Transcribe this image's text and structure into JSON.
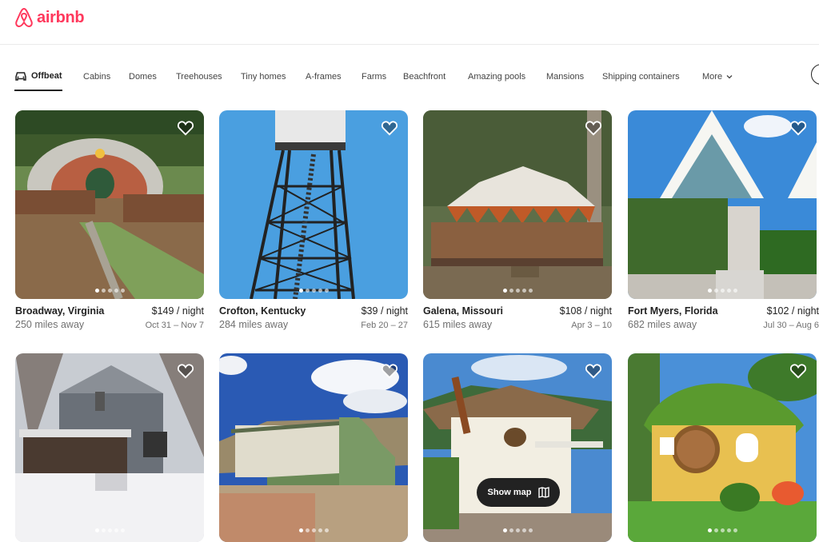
{
  "brand": {
    "name": "airbnb",
    "color": "#ff385c"
  },
  "categories": [
    {
      "label": "Offbeat",
      "icon": "car-icon",
      "active": true
    },
    {
      "label": "Cabins"
    },
    {
      "label": "Domes"
    },
    {
      "label": "Treehouses"
    },
    {
      "label": "Tiny homes"
    },
    {
      "label": "A-frames"
    },
    {
      "label": "Farms"
    },
    {
      "label": "Beachfront"
    },
    {
      "label": "Amazing pools"
    },
    {
      "label": "Mansions"
    },
    {
      "label": "Shipping containers"
    },
    {
      "label": "More"
    }
  ],
  "listings": [
    {
      "location": "Broadway, Virginia",
      "price": "$149 / night",
      "distance": "250 miles away",
      "dates": "Oct 31 – Nov 7"
    },
    {
      "location": "Crofton, Kentucky",
      "price": "$39 / night",
      "distance": "284 miles away",
      "dates": "Feb 20 – 27"
    },
    {
      "location": "Galena, Missouri",
      "price": "$108 / night",
      "distance": "615 miles away",
      "dates": "Apr 3 – 10"
    },
    {
      "location": "Fort Myers, Florida",
      "price": "$102 / night",
      "distance": "682 miles away",
      "dates": "Jul 30 – Aug 6"
    },
    {
      "location": "",
      "price": "",
      "distance": "",
      "dates": ""
    },
    {
      "location": "",
      "price": "",
      "distance": "",
      "dates": ""
    },
    {
      "location": "",
      "price": "",
      "distance": "",
      "dates": ""
    },
    {
      "location": "",
      "price": "",
      "distance": "",
      "dates": ""
    }
  ],
  "map_button": {
    "label": "Show map"
  }
}
